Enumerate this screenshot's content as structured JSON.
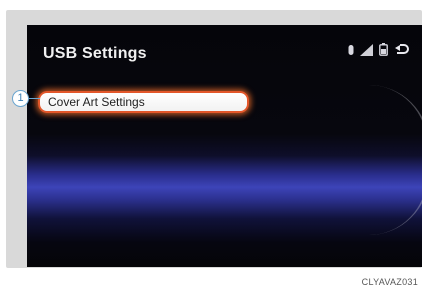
{
  "screen": {
    "title": "USB Settings",
    "menu_items": [
      {
        "label": "Cover Art Settings",
        "selected": true
      }
    ],
    "status_icons": [
      "bluetooth-icon",
      "signal-strength-icon",
      "battery-icon",
      "back-icon"
    ]
  },
  "annotation": {
    "callout_number": "1",
    "image_code": "CLYAVAZ031"
  },
  "colors": {
    "selection_border": "#e3572a",
    "screen_background": "#05050a",
    "accent_band": "#3d44b8",
    "callout": "#3a7fb5"
  }
}
